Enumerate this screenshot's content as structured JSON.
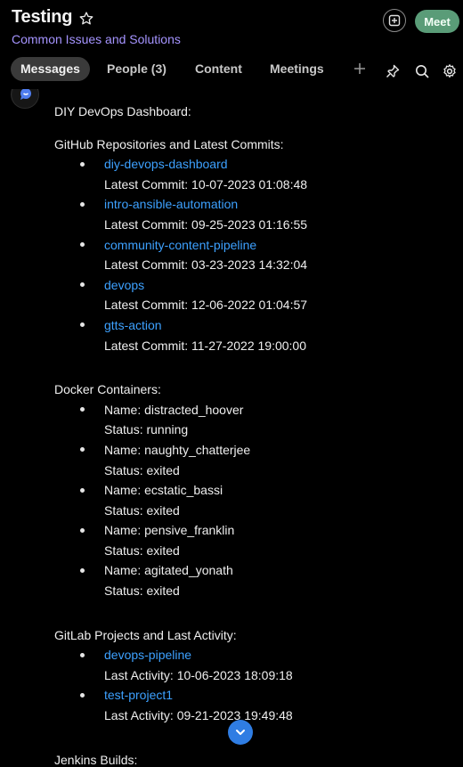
{
  "header": {
    "title": "Testing",
    "subtitle": "Common Issues and Solutions",
    "meet_label": "Meet"
  },
  "tabs": [
    {
      "label": "Messages",
      "active": true
    },
    {
      "label": "People (3)",
      "active": false
    },
    {
      "label": "Content",
      "active": false
    },
    {
      "label": "Meetings",
      "active": false
    }
  ],
  "toolbar_icons": [
    "plus-icon",
    "pin-icon",
    "search-icon",
    "gear-icon"
  ],
  "message": {
    "heading": "DIY DevOps Dashboard:",
    "github": {
      "title": "GitHub Repositories and Latest Commits:",
      "items": [
        {
          "name": "diy-devops-dashboard",
          "detail": "Latest Commit: 10-07-2023 01:08:48"
        },
        {
          "name": "intro-ansible-automation",
          "detail": "Latest Commit: 09-25-2023 01:16:55"
        },
        {
          "name": "community-content-pipeline",
          "detail": "Latest Commit: 03-23-2023 14:32:04"
        },
        {
          "name": "devops",
          "detail": "Latest Commit: 12-06-2022 01:04:57"
        },
        {
          "name": "gtts-action",
          "detail": "Latest Commit: 11-27-2022 19:00:00"
        }
      ]
    },
    "docker": {
      "title": "Docker Containers:",
      "items": [
        {
          "name": "Name: distracted_hoover",
          "detail": "Status: running"
        },
        {
          "name": "Name: naughty_chatterjee",
          "detail": "Status: exited"
        },
        {
          "name": "Name: ecstatic_bassi",
          "detail": "Status: exited"
        },
        {
          "name": "Name: pensive_franklin",
          "detail": "Status: exited"
        },
        {
          "name": "Name: agitated_yonath",
          "detail": "Status: exited"
        }
      ]
    },
    "gitlab": {
      "title": "GitLab Projects and Last Activity:",
      "items": [
        {
          "name": "devops-pipeline",
          "detail": "Last Activity: 10-06-2023 18:09:18"
        },
        {
          "name": "test-project1",
          "detail": "Last Activity: 09-21-2023 19:49:48"
        }
      ]
    },
    "jenkins_title": "Jenkins Builds:"
  },
  "colors": {
    "accent_purple": "#a594ff",
    "link_blue": "#3da1ff",
    "meet_green": "#5a9c78",
    "scroll_button_blue": "#2f7de3"
  }
}
